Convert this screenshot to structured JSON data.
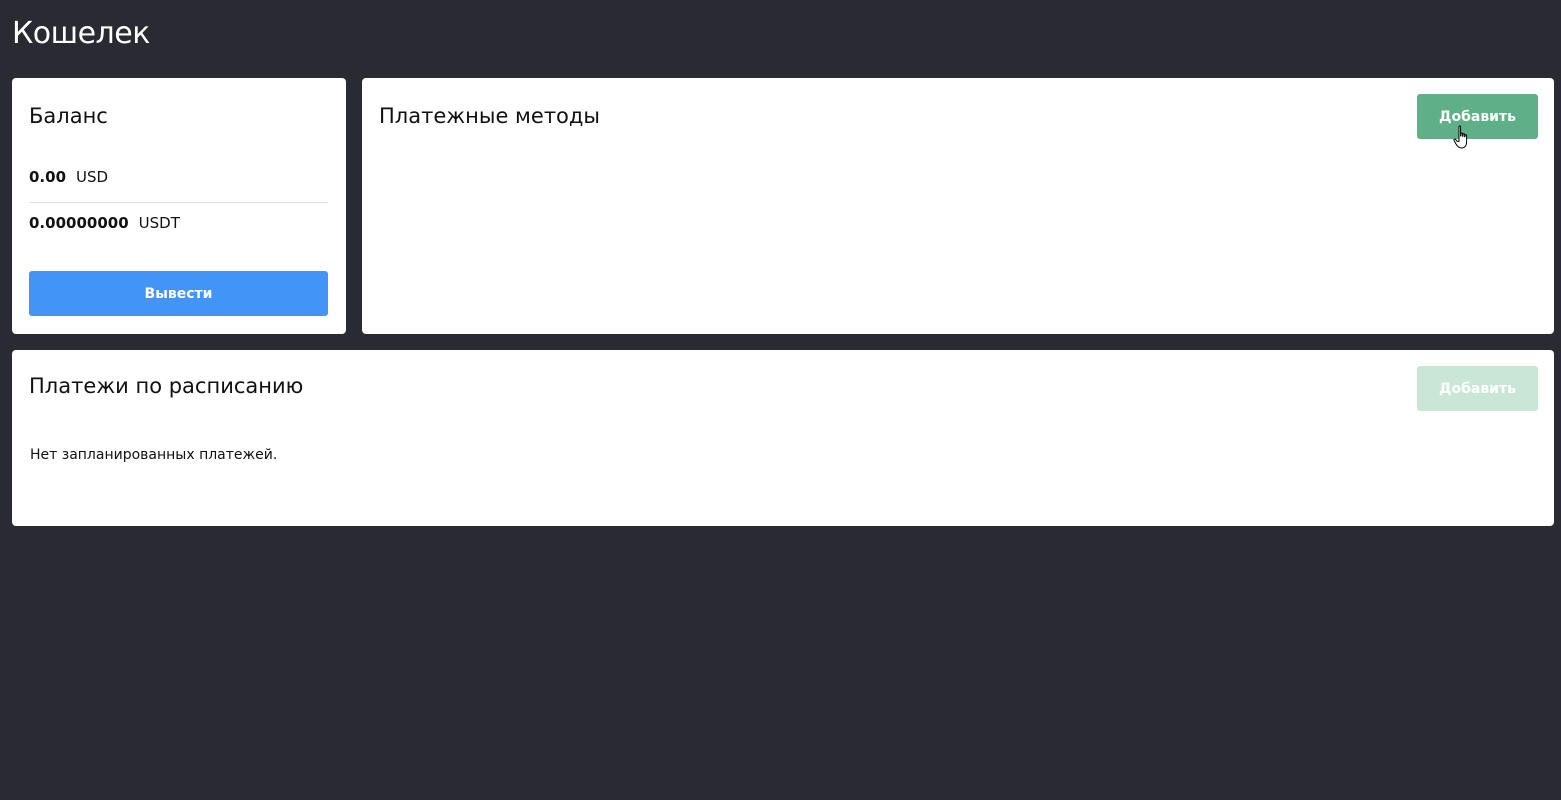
{
  "page": {
    "title": "Кошелек"
  },
  "balance": {
    "title": "Баланс",
    "items": [
      {
        "amount": "0.00",
        "currency": "USD"
      },
      {
        "amount": "0.00000000",
        "currency": "USDT"
      }
    ],
    "withdraw_label": "Вывести"
  },
  "payment_methods": {
    "title": "Платежные методы",
    "add_label": "Добавить"
  },
  "scheduled_payments": {
    "title": "Платежи по расписанию",
    "add_label": "Добавить",
    "empty_text": "Нет запланированных платежей."
  },
  "colors": {
    "background": "#2a2a33",
    "card": "#ffffff",
    "primary_button": "#4394f7",
    "add_button": "#5fb088",
    "add_button_disabled": "#c9e6d7"
  },
  "icons": {
    "cursor": "pointer-hand-icon"
  }
}
